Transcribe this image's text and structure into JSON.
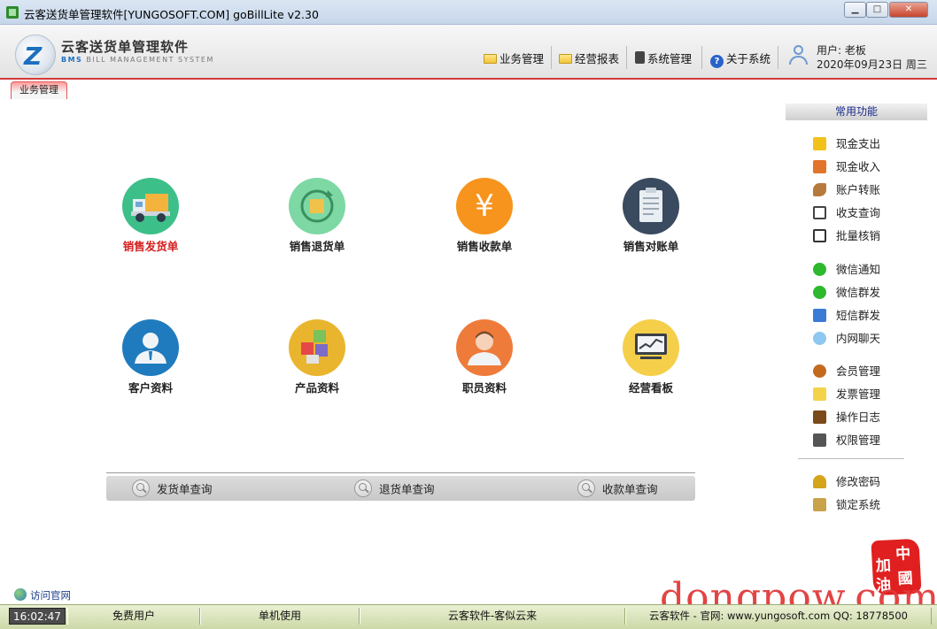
{
  "window": {
    "title": "云客送货单管理软件[YUNGOSOFT.COM]  goBillLite v2.30",
    "minimize": "▁",
    "maximize": "□",
    "close": "✕"
  },
  "header": {
    "logo_title": "云客送货单管理软件",
    "logo_sub_bms": "BMS",
    "logo_sub_rest": " BILL MANAGEMENT SYSTEM",
    "menu": [
      {
        "label": "业务管理",
        "icon": "folder-icon"
      },
      {
        "label": "经营报表",
        "icon": "folder-icon"
      },
      {
        "label": "系统管理",
        "icon": "system-icon"
      },
      {
        "label": "关于系统",
        "icon": "help-icon"
      }
    ],
    "user": "用户: 老板",
    "date": "2020年09月23日  周三"
  },
  "tab": {
    "label": "业务管理"
  },
  "tiles": [
    {
      "label": "销售发货单",
      "icon": "truck-icon",
      "color": "#3dbf89",
      "active": true
    },
    {
      "label": "销售退货单",
      "icon": "return-icon",
      "color": "#7dd8a4"
    },
    {
      "label": "销售收款单",
      "icon": "yen-icon",
      "color": "#f7941d"
    },
    {
      "label": "销售对账单",
      "icon": "clipboard-icon",
      "color": "#3a4a5f"
    },
    {
      "label": "客户资料",
      "icon": "customer-icon",
      "color": "#1f7bbd"
    },
    {
      "label": "产品资料",
      "icon": "product-icon",
      "color": "#e9b52e"
    },
    {
      "label": "职员资料",
      "icon": "staff-icon",
      "color": "#ef7b3b"
    },
    {
      "label": "经营看板",
      "icon": "dashboard-icon",
      "color": "#f5cf4a"
    }
  ],
  "queries": [
    {
      "label": "发货单查询"
    },
    {
      "label": "退货单查询"
    },
    {
      "label": "收款单查询"
    }
  ],
  "right_panel": {
    "title": "常用功能",
    "items": [
      {
        "label": "现金支出",
        "icon": "cash-out-icon",
        "color": "#f2c21a"
      },
      {
        "label": "现金收入",
        "icon": "cash-in-icon",
        "color": "#e3742b"
      },
      {
        "label": "账户转账",
        "icon": "transfer-icon",
        "color": "#b77a3d"
      },
      {
        "label": "收支查询",
        "icon": "query-icon",
        "color": "#444444"
      },
      {
        "label": "批量核销",
        "icon": "batch-icon",
        "color": "#333333"
      },
      {
        "label": "微信通知",
        "icon": "wechat-icon",
        "color": "#2eb82e"
      },
      {
        "label": "微信群发",
        "icon": "wechat-group-icon",
        "color": "#2eb82e"
      },
      {
        "label": "短信群发",
        "icon": "sms-icon",
        "color": "#3a7bd5"
      },
      {
        "label": "内网聊天",
        "icon": "chat-icon",
        "color": "#8ec7ef"
      },
      {
        "label": "会员管理",
        "icon": "member-icon",
        "color": "#c46a1f"
      },
      {
        "label": "发票管理",
        "icon": "invoice-icon",
        "color": "#f4d34a"
      },
      {
        "label": "操作日志",
        "icon": "log-icon",
        "color": "#7a4a1a"
      },
      {
        "label": "权限管理",
        "icon": "permission-icon",
        "color": "#555555"
      },
      {
        "label": "修改密码",
        "icon": "key-icon",
        "color": "#d4a41a"
      },
      {
        "label": "锁定系统",
        "icon": "lock-icon",
        "color": "#c9a24a"
      }
    ]
  },
  "visit_site": "访问官网",
  "stamp": [
    "加",
    "中",
    "油",
    "國"
  ],
  "watermark": "dongpow.com",
  "statusbar": {
    "time": "16:02:47",
    "cells": [
      "免费用户",
      "单机使用",
      "云客软件-客似云来",
      "云客软件 - 官网: www.yungosoft.com   QQ: 18778500"
    ]
  }
}
